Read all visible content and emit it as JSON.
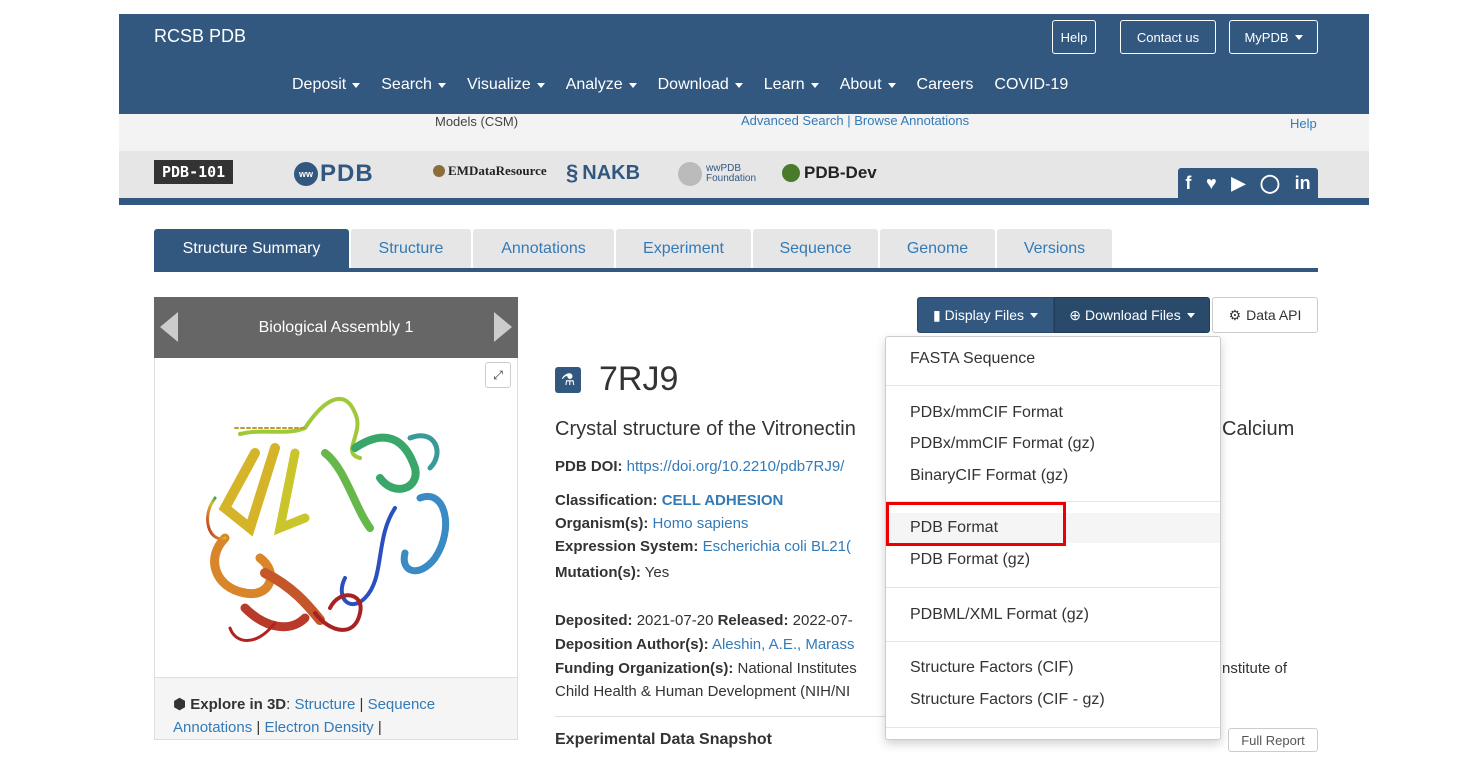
{
  "header": {
    "brand": "RCSB PDB",
    "help": "Help",
    "contact": "Contact us",
    "mypdb": "MyPDB",
    "nav": [
      "Deposit",
      "Search",
      "Visualize",
      "Analyze",
      "Download",
      "Learn",
      "About",
      "Careers",
      "COVID-19"
    ]
  },
  "subnav": {
    "csm": "Models (CSM)",
    "advanced": "Advanced Search | Browse Annotations",
    "help": "Help"
  },
  "partners": {
    "pdb101": "PDB-101",
    "wwpdb_pdb": "PDB",
    "emdr": "EMDataResource",
    "nakb": "NAKB",
    "wwpdb_foundation": "wwPDB Foundation",
    "pdbdev": "PDB-Dev"
  },
  "tabs": [
    "Structure Summary",
    "Structure",
    "Annotations",
    "Experiment",
    "Sequence",
    "Genome",
    "Versions"
  ],
  "assembly": {
    "title": "Biological Assembly 1",
    "explore_label": "Explore in 3D",
    "explore_links": [
      "Structure",
      "Sequence Annotations",
      "Electron Density"
    ]
  },
  "entry": {
    "id": "7RJ9",
    "title": "Crystal structure of the Vitronectin",
    "title_end": "Calcium",
    "doi_label": "PDB DOI:",
    "doi": "https://doi.org/10.2210/pdb7RJ9/",
    "classification_label": "Classification:",
    "classification": "CELL ADHESION",
    "organism_label": "Organism(s):",
    "organism": "Homo sapiens",
    "expression_label": "Expression System:",
    "expression": "Escherichia coli BL21(",
    "mutation_label": "Mutation(s):",
    "mutation": "Yes",
    "deposited_label": "Deposited:",
    "deposited": "2021-07-20",
    "released_label": "Released:",
    "released": "2022-07-",
    "authors_label": "Deposition Author(s):",
    "authors": "Aleshin, A.E., Marass",
    "funding_label": "Funding Organization(s):",
    "funding": "National Institutes",
    "funding_end": "nstitute of",
    "funding_line2": "Child Health & Human Development (NIH/NI",
    "snapshot": "Experimental Data Snapshot",
    "full_report": "Full Report"
  },
  "buttons": {
    "display_files": "Display Files",
    "download_files": "Download Files",
    "data_api": "Data API"
  },
  "download_menu": [
    "FASTA Sequence",
    "PDBx/mmCIF Format",
    "PDBx/mmCIF Format (gz)",
    "BinaryCIF Format (gz)",
    "PDB Format",
    "PDB Format (gz)",
    "PDBML/XML Format (gz)",
    "Structure Factors (CIF)",
    "Structure Factors (CIF - gz)"
  ],
  "colors": {
    "primary": "#325880",
    "link": "#337ab7",
    "highlight": "#ee0000"
  }
}
